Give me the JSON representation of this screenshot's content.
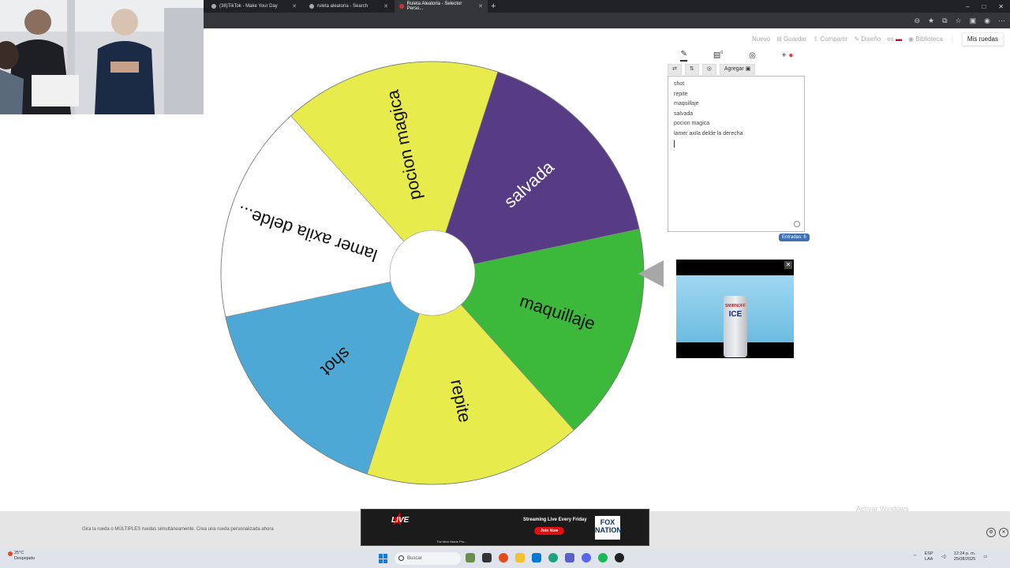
{
  "browser": {
    "tabs": [
      {
        "label": "(38)TikTok - Make Your Day",
        "active": false
      },
      {
        "label": "ruleta aleatoria - Search",
        "active": false
      },
      {
        "label": "Ruleta Aleatoria - Selector Perso...",
        "active": true
      }
    ],
    "new_tab_glyph": "+",
    "window_controls": [
      "–",
      "□",
      "✕"
    ]
  },
  "site_nav": {
    "items": [
      "Nuevo",
      "Guardar",
      "Compartir",
      "Diseño",
      "es"
    ],
    "biblioteca": "Biblioteca",
    "my_wheels": "Mis ruedas"
  },
  "wheel": {
    "slices": [
      {
        "label": "salvada",
        "color": "#573b84",
        "text_color": "#ffffff"
      },
      {
        "label": "maquillaje",
        "color": "#3cb93a",
        "text_color": "#111111"
      },
      {
        "label": "repite",
        "color": "#e7ec4c",
        "text_color": "#111111"
      },
      {
        "label": "shot",
        "color": "#4ea8d5",
        "text_color": "#111111"
      },
      {
        "label": "lamer axila delde...",
        "color": "#ffffff",
        "text_color": "#111111"
      },
      {
        "label": "pocion magica",
        "color": "#e7ec4c",
        "text_color": "#111111"
      }
    ],
    "pointer_color": "#a7a7a7"
  },
  "panel": {
    "toolbar_icons": [
      "pencil-icon",
      "clipboard-icon",
      "hide-icon",
      "palette-icon"
    ],
    "clipboard_badge": "0",
    "actions": {
      "shuffle": "⇄",
      "sort": "⇅",
      "image": "◎",
      "add": "Agregar ▣"
    },
    "entries": [
      "shot",
      "repite",
      "maquillaje",
      "salvada",
      "pocion magica",
      "lamer axila delde la derecha"
    ],
    "entries_count_label": "Entradas: 6"
  },
  "ad": {
    "brand": "SMIRNOFF",
    "product": "ICE",
    "close": "✕"
  },
  "footer": {
    "text": "Gira la rueda o MÚLTIPLES ruedas simultáneamente. Crea una rueda personalizada ahora"
  },
  "bottom_ad": {
    "live": "LIVE",
    "tagline": "The Mick Maxie Pro...",
    "headline": "Streaming Live Every Friday",
    "cta": "Join Now",
    "network": "FOX NATION"
  },
  "watermark": "Activar Windows",
  "taskbar": {
    "weather_temp": "25°C",
    "weather_desc": "Despejado",
    "search_placeholder": "Buscar",
    "lang_line1": "ESP",
    "lang_line2": "LAA",
    "time": "12:24 p. m.",
    "date": "25/08/2025"
  }
}
